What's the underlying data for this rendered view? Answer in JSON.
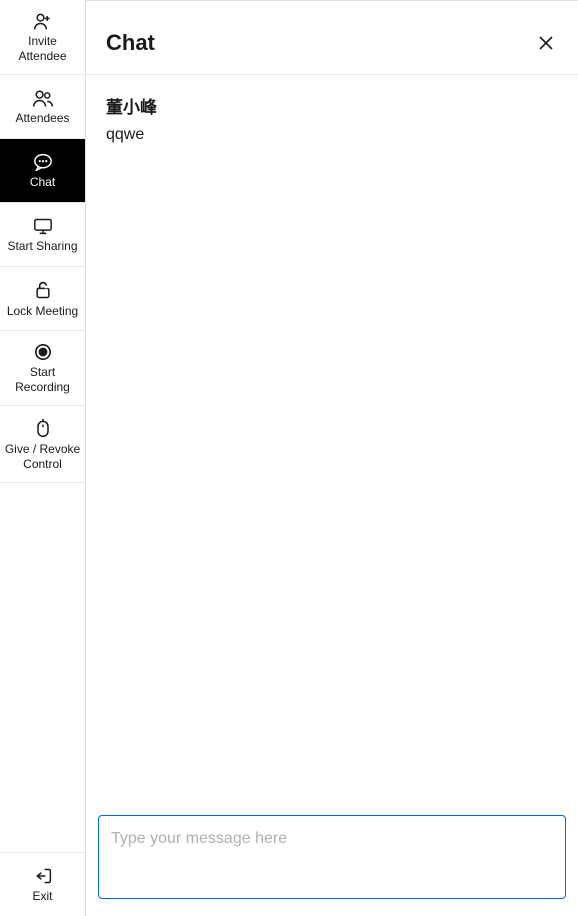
{
  "sidebar": {
    "items": [
      {
        "id": "invite-attendee",
        "label": "Invite Attendee",
        "icon": "person-plus-icon"
      },
      {
        "id": "attendees",
        "label": "Attendees",
        "icon": "people-icon"
      },
      {
        "id": "chat",
        "label": "Chat",
        "icon": "chat-icon",
        "active": true
      },
      {
        "id": "start-sharing",
        "label": "Start Sharing",
        "icon": "screen-icon"
      },
      {
        "id": "lock-meeting",
        "label": "Lock Meeting",
        "icon": "lock-open-icon"
      },
      {
        "id": "start-recording",
        "label": "Start Recording",
        "icon": "record-icon"
      },
      {
        "id": "give-revoke-control",
        "label": "Give / Revoke Control",
        "icon": "mouse-icon"
      }
    ],
    "exit": {
      "label": "Exit",
      "icon": "exit-icon"
    }
  },
  "chat": {
    "title": "Chat",
    "messages": [
      {
        "sender": "董小峰",
        "text": "qqwe"
      }
    ],
    "input_placeholder": "Type your message here",
    "input_value": ""
  }
}
